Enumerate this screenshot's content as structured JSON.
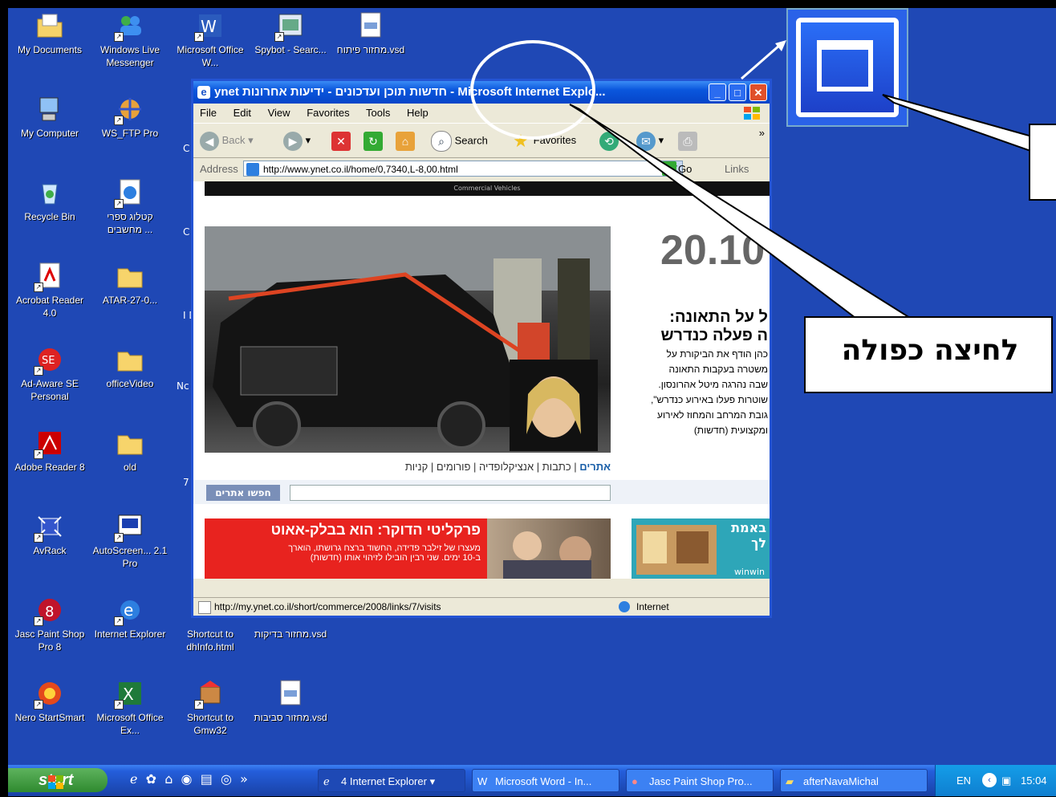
{
  "desktop_icons": [
    {
      "label": "My Documents",
      "icon": "folder-documents-icon"
    },
    {
      "label": "Windows Live Messenger",
      "icon": "messenger-icon"
    },
    {
      "label": "Microsoft Office W...",
      "icon": "word-icon"
    },
    {
      "label": "Spybot - Searc...",
      "icon": "spybot-icon"
    },
    {
      "label": "מחזור פיתוח.vsd",
      "icon": "visio-file-icon"
    },
    {
      "label": "My Computer",
      "icon": "computer-icon"
    },
    {
      "label": "WS_FTP Pro",
      "icon": "ftp-icon"
    },
    {
      "label": "Recycle Bin",
      "icon": "recycle-bin-icon"
    },
    {
      "label": "קטלוג ספרי מחשבים ...",
      "icon": "ie-shortcut-icon"
    },
    {
      "label": "Acrobat Reader 4.0",
      "icon": "acrobat-icon"
    },
    {
      "label": "ATAR-27-0...",
      "icon": "folder-icon"
    },
    {
      "label": "Ad-Aware SE Personal",
      "icon": "adaware-icon"
    },
    {
      "label": "officeVideo",
      "icon": "folder-icon"
    },
    {
      "label": "Adobe Reader 8",
      "icon": "adobe-reader-icon"
    },
    {
      "label": "old",
      "icon": "folder-icon"
    },
    {
      "label": "AvRack",
      "icon": "avrack-icon"
    },
    {
      "label": "AutoScreen... 2.1 Pro",
      "icon": "autoscreen-icon"
    },
    {
      "label": "Jasc Paint Shop Pro 8",
      "icon": "paintshop-icon"
    },
    {
      "label": "Internet Explorer",
      "icon": "ie-icon"
    },
    {
      "label": "Shortcut to dhInfo.html",
      "icon": "html-shortcut-icon"
    },
    {
      "label": "מחזור בדיקות.vsd",
      "icon": "visio-file-icon"
    },
    {
      "label": "Nero StartSmart",
      "icon": "nero-icon"
    },
    {
      "label": "Microsoft Office Ex...",
      "icon": "excel-icon"
    },
    {
      "label": "Shortcut to Gmw32",
      "icon": "gmw-icon"
    },
    {
      "label": "מחזור סביבות.vsd",
      "icon": "visio-file-icon"
    }
  ],
  "partial_labels": [
    "C",
    "C",
    "C",
    "I Dc",
    "Nc",
    "7"
  ],
  "ie_window": {
    "title": "ynet חדשות תוכן ועדכונים - ידיעות אחרונות - Microsoft Internet Explo...",
    "menu": [
      "File",
      "Edit",
      "View",
      "Favorites",
      "Tools",
      "Help"
    ],
    "toolbar": {
      "back": "Back",
      "search": "Search",
      "favorites": "Favorites",
      "more": "»"
    },
    "address_label": "Address",
    "address_url": "http://www.ynet.co.il/home/0,7340,L-8,00.html",
    "go_label": "Go",
    "links_label": "Links",
    "status_url": "http://my.ynet.co.il/short/commerce/2008/links/7/visits",
    "status_zone": "Internet"
  },
  "page": {
    "banner_text": "Commercial Vehicles",
    "date": "20.10",
    "headline_line1": "ל על התאונה:",
    "headline_line2": "ה פעלה כנדרש",
    "body_lines": [
      "כהן הודף את הביקורת על",
      "משטרה בעקבות התאונה",
      "שבה נהרגה מיטל אהרונסון.",
      "שוטרות פעלו באירוע כנדרש\",",
      "גובת המרחב והמחוז לאירוע",
      "ומקצועית (חדשות)"
    ],
    "nav_links": [
      "אתרים",
      "כתבות",
      "אנציקלופדיה",
      "פורומים",
      "קניות"
    ],
    "search_button": "חפשו אתרים",
    "promo_title": "פרקליטי הדוקר: הוא בבלק-אאוט",
    "promo_text1": "מעצרו של זילבר פדידה, החשוד ברצח גרושתו, הוארך",
    "promo_text2": "ב-10 ימים. שני רבין הובילו לזיהוי אותו (חדשות)",
    "side_title": "באמת לך",
    "side_small": "winwin"
  },
  "taskbar": {
    "start_label": "start",
    "tasks": [
      {
        "label": "4 Internet Explorer",
        "icon": "ie-icon"
      },
      {
        "label": "Microsoft Word - In...",
        "icon": "word-icon"
      },
      {
        "label": "Jasc Paint Shop Pro...",
        "icon": "paintshop-icon"
      },
      {
        "label": "afterNavaMichal",
        "icon": "folder-icon"
      }
    ],
    "language": "EN",
    "clock": "15:04"
  },
  "annotation": {
    "callout_text": "לחיצה כפולה"
  },
  "colors": {
    "desktop": "#1f48b5",
    "titlebar": "#0a56dd",
    "promo_red": "#e8231f"
  }
}
